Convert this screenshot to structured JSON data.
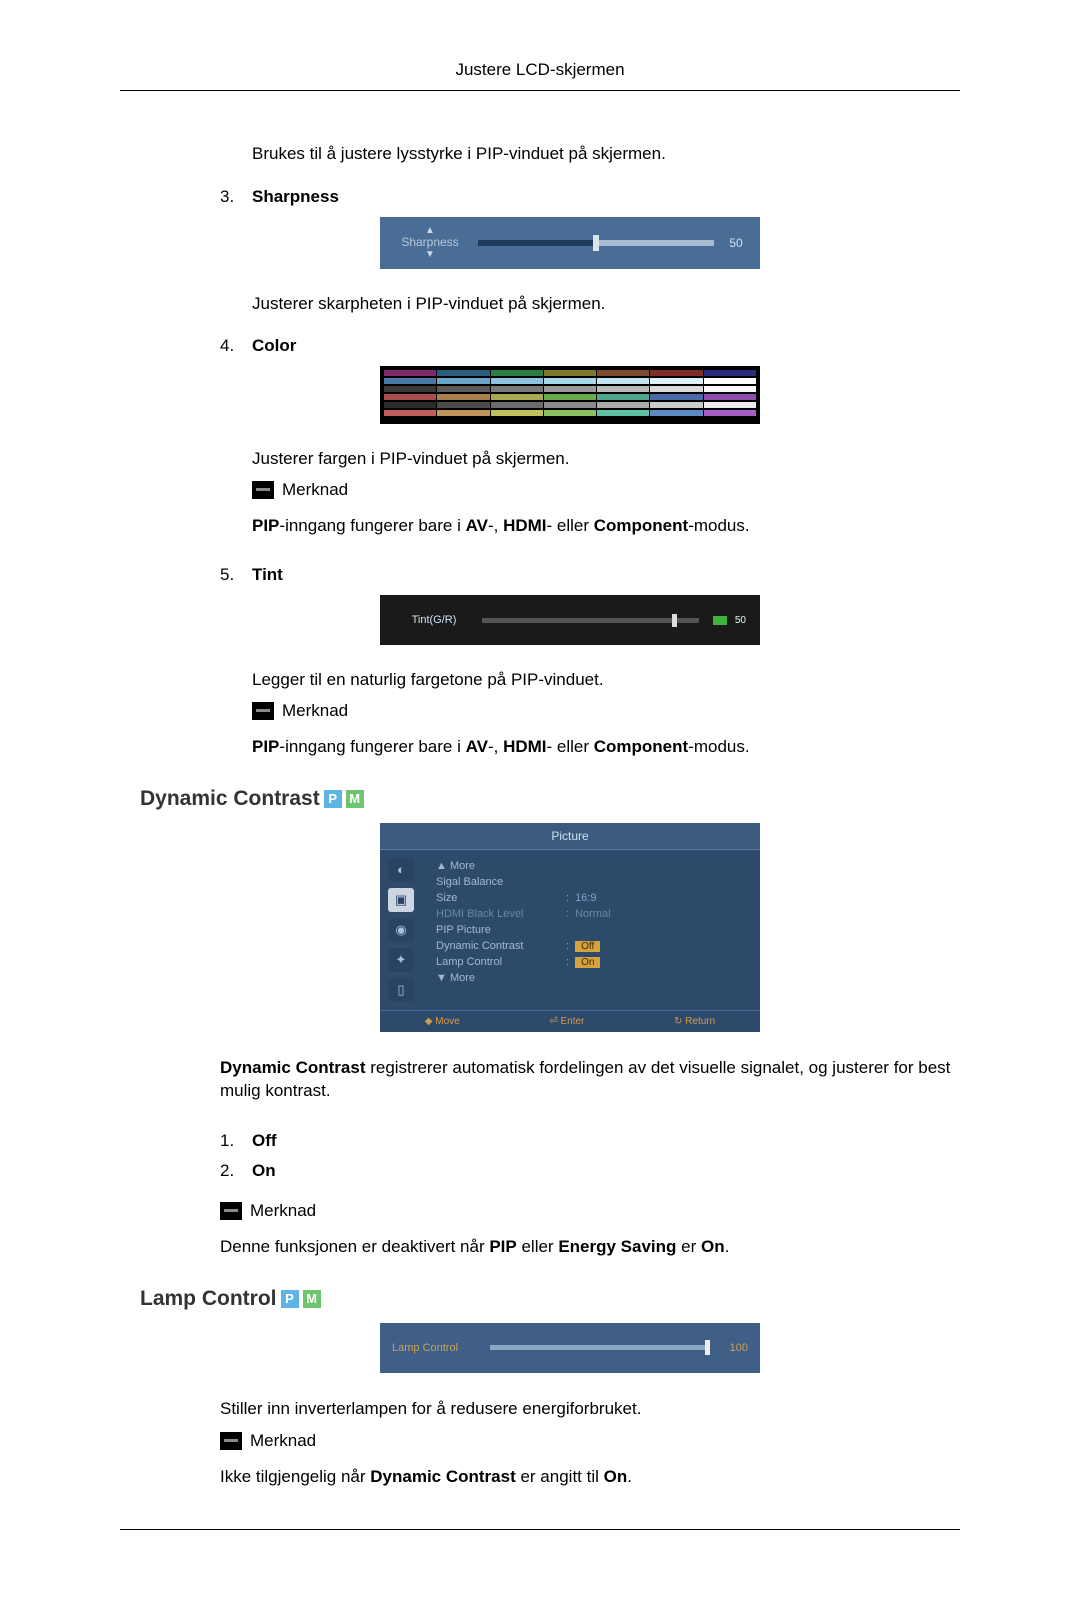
{
  "header": {
    "title": "Justere LCD-skjermen"
  },
  "intro": "Brukes til å justere lysstyrke i PIP-vinduet på skjermen.",
  "items": {
    "sharpness": {
      "num": "3.",
      "label": "Sharpness",
      "slider_label": "Sharpness",
      "slider_value": "50",
      "desc": "Justerer skarpheten i PIP-vinduet på skjermen."
    },
    "color": {
      "num": "4.",
      "label": "Color",
      "desc": "Justerer fargen i PIP-vinduet på skjermen.",
      "note_label": "Merknad",
      "note_text_pre": "PIP",
      "note_text_mid1": "-inngang fungerer bare i ",
      "note_bold1": "AV",
      "note_sep": "-, ",
      "note_bold2": "HDMI",
      "note_sep2": "- eller ",
      "note_bold3": "Component",
      "note_text_end": "-modus."
    },
    "tint": {
      "num": "5.",
      "label": "Tint",
      "slider_label": "Tint(G/R)",
      "slider_value": "50",
      "desc": "Legger til en naturlig fargetone på PIP-vinduet.",
      "note_label": "Merknad",
      "note_text_pre": "PIP",
      "note_text_mid1": "-inngang fungerer bare i ",
      "note_bold1": "AV",
      "note_sep": "-, ",
      "note_bold2": "HDMI",
      "note_sep2": "- eller ",
      "note_bold3": "Component",
      "note_text_end": "-modus."
    }
  },
  "dynamic": {
    "title": "Dynamic Contrast",
    "badge_p": "P",
    "badge_m": "M",
    "menu_title": "Picture",
    "menu_items": [
      {
        "k": "▲ More",
        "v": ""
      },
      {
        "k": "Sigal Balance",
        "v": ""
      },
      {
        "k": "Size",
        "v": "16:9"
      },
      {
        "k": "HDMI Black Level",
        "v": "Normal",
        "dim": true
      },
      {
        "k": "PIP Picture",
        "v": ""
      },
      {
        "k": "Dynamic Contrast",
        "v": "Off",
        "pill": true
      },
      {
        "k": "Lamp Control",
        "v": "On",
        "pill": true
      },
      {
        "k": "▼ More",
        "v": ""
      }
    ],
    "menu_foot": {
      "move": "Move",
      "enter": "Enter",
      "ret": "Return"
    },
    "desc_bold": "Dynamic Contrast",
    "desc_rest": " registrerer automatisk fordelingen av det visuelle signalet, og justerer for best mulig kontrast.",
    "opt1_num": "1.",
    "opt1": "Off",
    "opt2_num": "2.",
    "opt2": "On",
    "note_label": "Merknad",
    "note_pre": "Denne funksjonen er deaktivert når ",
    "note_b1": "PIP",
    "note_mid": " eller ",
    "note_b2": "Energy Saving",
    "note_mid2": " er ",
    "note_b3": "On",
    "note_end": "."
  },
  "lamp": {
    "title": "Lamp Control",
    "badge_p": "P",
    "badge_m": "M",
    "slider_label": "Lamp Control",
    "slider_value": "100",
    "desc": "Stiller inn inverterlampen for å redusere energiforbruket.",
    "note_label": "Merknad",
    "note_pre": "Ikke tilgjengelig når ",
    "note_b1": "Dynamic Contrast",
    "note_mid": " er angitt til ",
    "note_b2": "On",
    "note_end": "."
  }
}
